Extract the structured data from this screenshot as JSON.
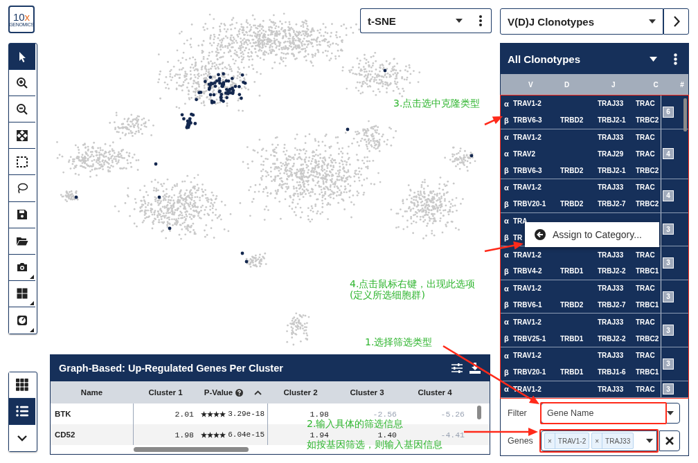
{
  "logo": {
    "number": "10",
    "letter": "x",
    "subtitle": "GENOMICS"
  },
  "tools": [
    {
      "kind": "pointer",
      "selected": true,
      "submenu": false
    },
    {
      "kind": "zoom-in",
      "selected": false,
      "submenu": false
    },
    {
      "kind": "zoom-out",
      "selected": false,
      "submenu": false
    },
    {
      "kind": "fit",
      "selected": false,
      "submenu": false
    },
    {
      "kind": "box-select",
      "selected": false,
      "submenu": false
    },
    {
      "kind": "lasso",
      "selected": false,
      "submenu": false
    },
    {
      "kind": "save",
      "selected": false,
      "submenu": false
    },
    {
      "kind": "open",
      "selected": false,
      "submenu": false
    },
    {
      "kind": "camera",
      "selected": false,
      "submenu": true
    },
    {
      "kind": "layout",
      "selected": false,
      "submenu": true
    },
    {
      "kind": "gauge",
      "selected": false,
      "submenu": true
    }
  ],
  "view_buttons": [
    {
      "kind": "grid",
      "selected": false
    },
    {
      "kind": "list",
      "selected": true
    },
    {
      "kind": "chevron",
      "selected": false
    }
  ],
  "projection": {
    "value": "t-SNE"
  },
  "gene_table": {
    "title": "Graph-Based: Up-Regulated Genes Per Cluster",
    "columns": [
      {
        "label": "Name",
        "help": false,
        "sorted": false
      },
      {
        "label": "Cluster 1",
        "help": false,
        "sorted": false
      },
      {
        "label": "P-Value",
        "help": true,
        "sorted": true
      },
      {
        "label": "Cluster 2",
        "help": false,
        "sorted": false
      },
      {
        "label": "Cluster 3",
        "help": false,
        "sorted": false
      },
      {
        "label": "Cluster 4",
        "help": false,
        "sorted": false
      }
    ],
    "rows": [
      {
        "name": "BTK",
        "stars": 4,
        "p_value": "3.29e-18",
        "values": [
          {
            "text": "2.01",
            "dim": false
          },
          {
            "text": "1.98",
            "dim": false
          },
          {
            "text": "-2.56",
            "dim": true
          },
          {
            "text": "-5.26",
            "dim": true
          }
        ]
      },
      {
        "name": "CD52",
        "stars": 4,
        "p_value": "6.04e-15",
        "values": [
          {
            "text": "1.98",
            "dim": false
          },
          {
            "text": "1.94",
            "dim": false
          },
          {
            "text": "1.40",
            "dim": false
          },
          {
            "text": "-4.41",
            "dim": true
          }
        ]
      }
    ]
  },
  "clonotype_view": {
    "value": "V(D)J Clonotypes"
  },
  "clonotypes": {
    "title": "All Clonotypes",
    "columns": [
      "V",
      "D",
      "J",
      "C",
      "#"
    ],
    "highlighted": true,
    "rows": [
      {
        "selected": true,
        "count": "6",
        "chains": [
          {
            "chain": "α",
            "v": "TRAV1-2",
            "j": "TRAJ33",
            "c": "TRAC"
          },
          {
            "chain": "β",
            "v": "TRBV6-3",
            "d": "TRBD2",
            "j": "TRBJ2-1",
            "c": "TRBC2"
          }
        ]
      },
      {
        "selected": true,
        "count": "4",
        "chains": [
          {
            "chain": "α",
            "v": "TRAV1-2",
            "j": "TRAJ33",
            "c": "TRAC"
          },
          {
            "chain": "α",
            "v": "TRAV2",
            "j": "TRAJ29",
            "c": "TRAC"
          },
          {
            "chain": "β",
            "v": "TRBV6-3",
            "d": "TRBD2",
            "j": "TRBJ2-1",
            "c": "TRBC2"
          }
        ]
      },
      {
        "selected": true,
        "count": "4",
        "chains": [
          {
            "chain": "α",
            "v": "TRAV1-2",
            "j": "TRAJ33",
            "c": "TRAC"
          },
          {
            "chain": "β",
            "v": "TRBV20-1",
            "d": "TRBD2",
            "j": "TRBJ2-7",
            "c": "TRBC2"
          }
        ]
      },
      {
        "selected": true,
        "count": "3",
        "chains": [
          {
            "chain": "α",
            "v": "TRA"
          },
          {
            "chain": "β",
            "v": "TR"
          }
        ],
        "context_menu": {
          "label": "Assign to Category..."
        }
      },
      {
        "selected": true,
        "count": "3",
        "chains": [
          {
            "chain": "α",
            "v": "TRAV1-2",
            "j": "TRAJ33",
            "c": "TRAC"
          },
          {
            "chain": "β",
            "v": "TRBV4-2",
            "d": "TRBD1",
            "j": "TRBJ2-2",
            "c": "TRBC1"
          }
        ]
      },
      {
        "selected": true,
        "count": "3",
        "chains": [
          {
            "chain": "α",
            "v": "TRAV1-2",
            "j": "TRAJ33",
            "c": "TRAC"
          },
          {
            "chain": "β",
            "v": "TRBV6-1",
            "d": "TRBD2",
            "j": "TRBJ2-7",
            "c": "TRBC1"
          }
        ]
      },
      {
        "selected": true,
        "count": "3",
        "chains": [
          {
            "chain": "α",
            "v": "TRAV1-2",
            "j": "TRAJ33",
            "c": "TRAC"
          },
          {
            "chain": "β",
            "v": "TRBV25-1",
            "d": "TRBD1",
            "j": "TRBJ2-2",
            "c": "TRBC2"
          }
        ]
      },
      {
        "selected": true,
        "count": "3",
        "chains": [
          {
            "chain": "α",
            "v": "TRAV1-2",
            "j": "TRAJ33",
            "c": "TRAC"
          },
          {
            "chain": "β",
            "v": "TRBV20-1",
            "d": "TRBD1",
            "j": "TRBJ1-6",
            "c": "TRBC1"
          }
        ]
      },
      {
        "selected": true,
        "count": "3",
        "chains": [
          {
            "chain": "α",
            "v": "TRAV1-2",
            "j": "TRAJ33",
            "c": "TRAC"
          }
        ]
      }
    ],
    "filter": {
      "label": "Filter",
      "value": "Gene Name",
      "highlighted": true
    },
    "genes": {
      "label": "Genes",
      "highlighted": true,
      "tags": [
        {
          "remove": "×",
          "label": "TRAV1-2"
        },
        {
          "remove": "×",
          "label": "TRAJ33"
        }
      ]
    }
  },
  "annotations": {
    "notes": [
      {
        "lines": [
          "3.点击选中克隆类型"
        ]
      },
      {
        "lines": [
          "4.点击鼠标右键，出现此选项",
          "(定义所选细胞群)"
        ]
      },
      {
        "lines": [
          "1.选择筛选类型"
        ]
      },
      {
        "lines": [
          "2.输入具体的筛选信息",
          "如按基因筛选，则输入基因信息"
        ]
      }
    ]
  }
}
